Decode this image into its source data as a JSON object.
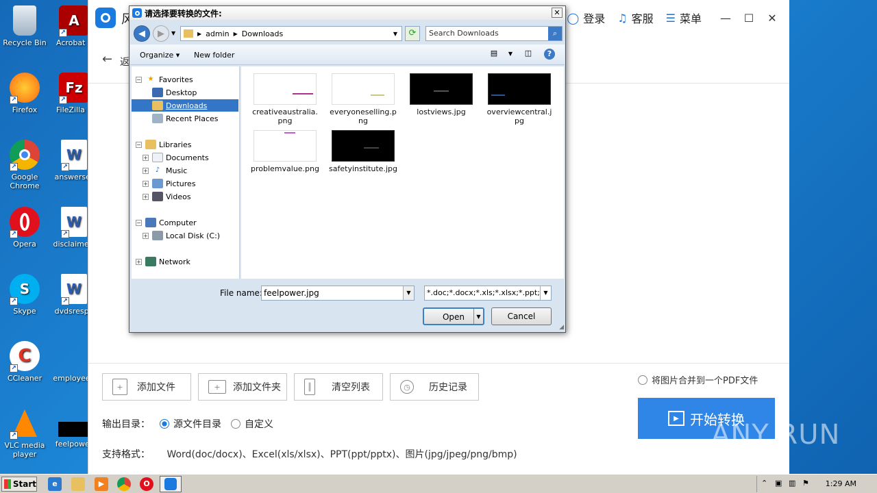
{
  "desktop": {
    "icons": [
      {
        "label": "Recycle Bin",
        "icon": "recycle-bin-icon"
      },
      {
        "label": "Acrobat Reader DC",
        "icon": "acrobat-icon"
      },
      {
        "label": "Firefox",
        "icon": "firefox-icon"
      },
      {
        "label": "FileZilla Client",
        "icon": "filezilla-icon"
      },
      {
        "label": "Google Chrome",
        "icon": "chrome-icon"
      },
      {
        "label": "answerser",
        "icon": "word-doc-icon"
      },
      {
        "label": "Opera",
        "icon": "opera-icon"
      },
      {
        "label": "disclaimerr",
        "icon": "word-doc-icon"
      },
      {
        "label": "Skype",
        "icon": "skype-icon"
      },
      {
        "label": "dvdsrespe",
        "icon": "word-doc-icon"
      },
      {
        "label": "CCleaner",
        "icon": "ccleaner-icon"
      },
      {
        "label": "employeep",
        "icon": "image-file-icon"
      },
      {
        "label": "VLC media player",
        "icon": "vlc-icon"
      },
      {
        "label": "feelpower",
        "icon": "image-file-icon"
      }
    ]
  },
  "app": {
    "title_fragment": "风",
    "login": "登录",
    "service": "客服",
    "menu": "菜单",
    "back_label": "返",
    "buttons": {
      "add_file": "添加文件",
      "add_folder": "添加文件夹",
      "clear_list": "清空列表",
      "history": "历史记录"
    },
    "merge_label": "将图片合并到一个PDF文件",
    "start_convert": "开始转换",
    "output_dir_label": "输出目录：",
    "output_source": "源文件目录",
    "output_custom": "自定义",
    "formats_label": "支持格式：",
    "formats_value": "Word(doc/docx)、Excel(xls/xlsx)、PPT(ppt/pptx)、图片(jpg/jpeg/png/bmp)"
  },
  "dialog": {
    "title": "请选择要转换的文件:",
    "breadcrumb": [
      "admin",
      "Downloads"
    ],
    "search_placeholder": "Search Downloads",
    "organize": "Organize",
    "new_folder": "New folder",
    "tree": {
      "favorites": "Favorites",
      "desktop": "Desktop",
      "downloads": "Downloads",
      "recent": "Recent Places",
      "libraries": "Libraries",
      "documents": "Documents",
      "music": "Music",
      "pictures": "Pictures",
      "videos": "Videos",
      "computer": "Computer",
      "local_disk": "Local Disk (C:)",
      "network": "Network"
    },
    "files": [
      {
        "name": "creativeaustralia.png",
        "thumb": "light",
        "mark": "#b03090"
      },
      {
        "name": "everyoneselling.png",
        "thumb": "light",
        "mark": "#c8c880"
      },
      {
        "name": "lostviews.jpg",
        "thumb": "dark",
        "mark": "#555555"
      },
      {
        "name": "overviewcentral.jpg",
        "thumb": "dark",
        "mark": "#3050a0"
      },
      {
        "name": "problemvalue.png",
        "thumb": "light",
        "mark": "#c060d0"
      },
      {
        "name": "safetyinstitute.jpg",
        "thumb": "dark",
        "mark": "#444444"
      }
    ],
    "file_name_label": "File name:",
    "file_name_value": "feelpower.jpg",
    "file_type_value": "*.doc;*.docx;*.xls;*.xlsx;*.ppt;*.p",
    "open": "Open",
    "cancel": "Cancel"
  },
  "taskbar": {
    "start": "Start",
    "clock": "1:29 AM"
  },
  "watermark": "ANY RUN"
}
